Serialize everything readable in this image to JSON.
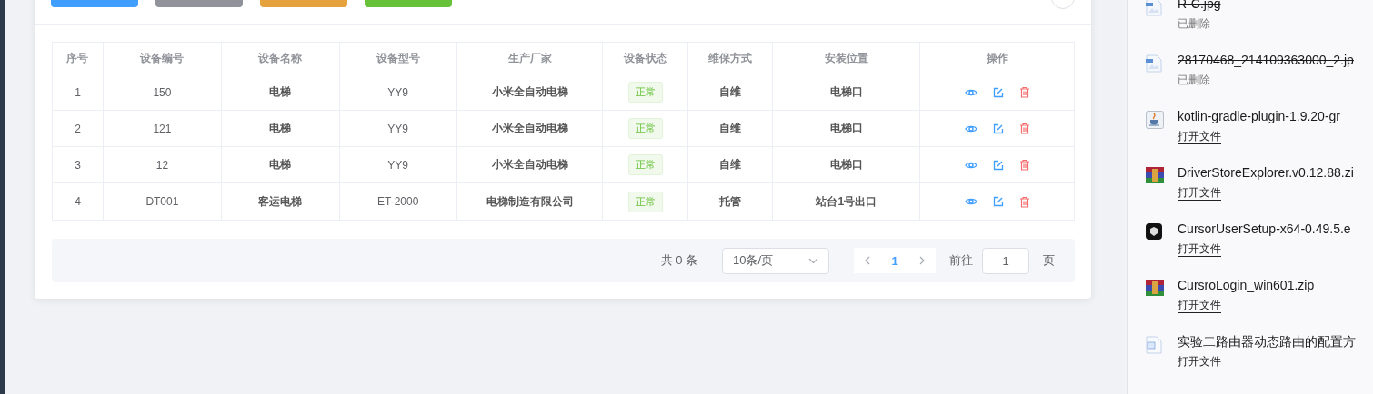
{
  "toolbar_buttons": [
    {
      "color": "#409eff"
    },
    {
      "color": "#909399"
    },
    {
      "color": "#e6a23c"
    },
    {
      "color": "#67c23a"
    }
  ],
  "table": {
    "columns": [
      "序号",
      "设备编号",
      "设备名称",
      "设备型号",
      "生产厂家",
      "设备状态",
      "维保方式",
      "安装位置",
      "操作"
    ],
    "rows": [
      {
        "index": "1",
        "code": "150",
        "name": "电梯",
        "model": "YY9",
        "maker": "小米全自动电梯",
        "status": "正常",
        "maintenance": "自维",
        "location": "电梯口"
      },
      {
        "index": "2",
        "code": "121",
        "name": "电梯",
        "model": "YY9",
        "maker": "小米全自动电梯",
        "status": "正常",
        "maintenance": "自维",
        "location": "电梯口"
      },
      {
        "index": "3",
        "code": "12",
        "name": "电梯",
        "model": "YY9",
        "maker": "小米全自动电梯",
        "status": "正常",
        "maintenance": "自维",
        "location": "电梯口"
      },
      {
        "index": "4",
        "code": "DT001",
        "name": "客运电梯",
        "model": "ET-2000",
        "maker": "电梯制造有限公司",
        "status": "正常",
        "maintenance": "托管",
        "location": "站台1号出口"
      }
    ]
  },
  "pagination": {
    "total": "共 0 条",
    "page_size": "10条/页",
    "pages": [
      {
        "label": "1",
        "selected": true
      }
    ],
    "goto_label": "前往",
    "goto_value": "1",
    "goto_suffix": "页"
  },
  "downloads": [
    {
      "kind": "image",
      "name": "R-C.jpg",
      "deleted": true,
      "status": "已删除"
    },
    {
      "kind": "image",
      "name": "28170468_214109363000_2.jp",
      "deleted": true,
      "status": "已删除"
    },
    {
      "kind": "java",
      "name": "kotlin-gradle-plugin-1.9.20-gr",
      "deleted": false,
      "status": "打开文件"
    },
    {
      "kind": "archive",
      "name": "DriverStoreExplorer.v0.12.88.zi",
      "deleted": false,
      "status": "打开文件"
    },
    {
      "kind": "app",
      "name": "CursorUserSetup-x64-0.49.5.e",
      "deleted": false,
      "status": "打开文件"
    },
    {
      "kind": "archive",
      "name": "CursroLogin_win601.zip",
      "deleted": false,
      "status": "打开文件"
    },
    {
      "kind": "doc",
      "name": "实验二路由器动态路由的配置方",
      "deleted": false,
      "status": "打开文件"
    }
  ]
}
